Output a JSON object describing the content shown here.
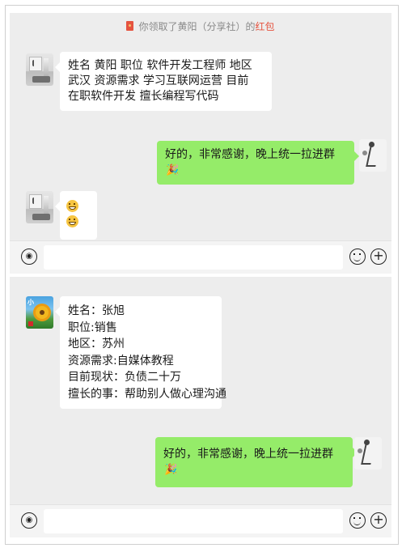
{
  "chat1": {
    "notice": {
      "prefix": "你领取了黄阳（分享社）的",
      "highlight": "红包"
    },
    "incoming_profile": [
      "姓名 黄阳  职位 软件开发工程师  地区",
      "武汉 资源需求 学习互联网运营 目前",
      "在职软件开发  擅长编程写代码"
    ],
    "outgoing_text": "好的，非常感谢，晚上统一拉进群",
    "outgoing_emoji": "🎉",
    "incoming_emoji_count": 2
  },
  "chat2": {
    "incoming_profile": [
      "姓名：张旭",
      "职位:销售",
      "地区：苏州",
      "资源需求:自媒体教程",
      "目前现状：负债二十万",
      "擅长的事：帮助别人做心理沟通"
    ],
    "outgoing_text": "好的，非常感谢，晚上统一拉进群",
    "outgoing_emoji": "🎉",
    "avatar_label": "小"
  },
  "input_bar": {
    "voice_icon": "voice-icon",
    "emoji_icon": "emoji-icon",
    "plus_icon": "plus-icon"
  },
  "colors": {
    "chat_bg": "#ededed",
    "outgoing_bubble": "#95ec69",
    "incoming_bubble": "#ffffff",
    "red_packet": "#e5533f"
  }
}
